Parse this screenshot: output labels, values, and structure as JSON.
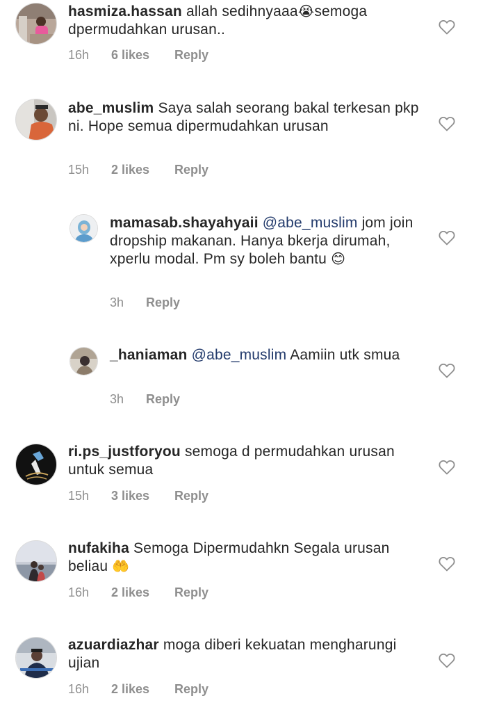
{
  "comments": [
    {
      "username": "hasmiza.hassan",
      "text": "allah sedihnyaaa",
      "emoji": "😭",
      "text_after": "semoga dpermudahkan urusan..",
      "time": "16h",
      "likes": "6 likes",
      "reply": "Reply"
    },
    {
      "username": "abe_muslim",
      "text": "Saya salah seorang bakal terkesan pkp ni. Hope semua dipermudahkan urusan",
      "time": "15h",
      "likes": "2 likes",
      "reply": "Reply"
    },
    {
      "username": "mamasab.shayahyaii",
      "mention": "@abe_muslim",
      "text": "jom join dropship makanan. Hanya bkerja dirumah, xperlu modal. Pm sy boleh bantu",
      "emoji": "😊",
      "time": "3h",
      "reply": "Reply"
    },
    {
      "username": "_haniaman",
      "mention": "@abe_muslim",
      "text": "Aamiin utk smua",
      "time": "3h",
      "reply": "Reply"
    },
    {
      "username": "ri.ps_justforyou",
      "text": "semoga d permudahkan urusan untuk semua",
      "time": "15h",
      "likes": "3 likes",
      "reply": "Reply"
    },
    {
      "username": "nufakiha",
      "text": "Semoga Dipermudahkn Segala urusan beliau",
      "emoji": "🤲",
      "time": "16h",
      "likes": "2 likes",
      "reply": "Reply"
    },
    {
      "username": "azuardiazhar",
      "text": "moga diberi kekuatan mengharungi ujian",
      "time": "16h",
      "likes": "2 likes",
      "reply": "Reply"
    }
  ],
  "icons": {
    "like": "heart-outline-icon"
  },
  "colors": {
    "mention": "#223a6b",
    "meta": "#8e8e8e",
    "text": "#262626"
  }
}
